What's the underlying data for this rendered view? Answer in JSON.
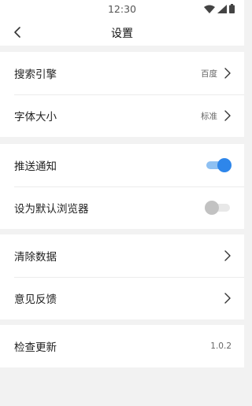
{
  "status_bar": {
    "time": "12:30"
  },
  "header": {
    "title": "设置"
  },
  "groups": [
    {
      "items": [
        {
          "label": "搜索引擎",
          "value": "百度"
        },
        {
          "label": "字体大小",
          "value": "标准"
        }
      ]
    },
    {
      "items": [
        {
          "label": "推送通知",
          "toggle": true
        },
        {
          "label": "设为默认浏览器",
          "toggle": false
        }
      ]
    },
    {
      "items": [
        {
          "label": "清除数据"
        },
        {
          "label": "意见反馈"
        }
      ]
    },
    {
      "items": [
        {
          "label": "检查更新",
          "value": "1.0.2"
        }
      ]
    }
  ],
  "colors": {
    "accent": "#2e86ea",
    "accent_track": "#8ec0f2",
    "background": "#f2f2f2"
  },
  "icons": {
    "back": "chevron-left-icon",
    "row_arrow": "chevron-right-icon",
    "wifi": "wifi-icon",
    "signal": "signal-icon",
    "battery": "battery-icon"
  }
}
